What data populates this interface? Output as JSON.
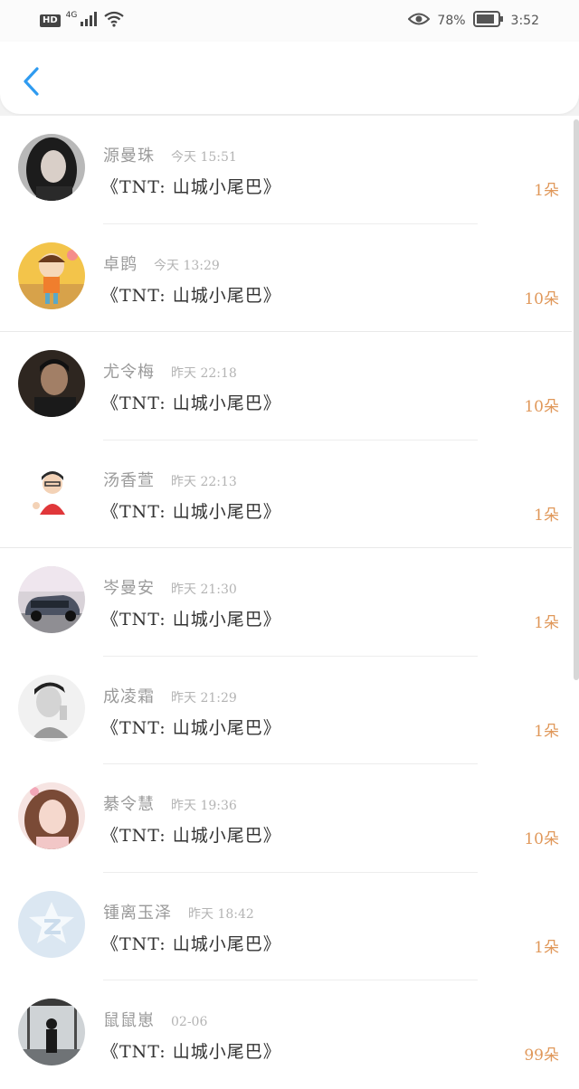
{
  "status_bar": {
    "hd": "HD",
    "network": "4G",
    "battery_percent": "78%",
    "time": "3:52"
  },
  "icons": {
    "back": "chevron-left-icon",
    "signal": "signal-icon",
    "wifi": "wifi-icon",
    "eye": "eye-icon",
    "battery": "battery-icon"
  },
  "colors": {
    "accent": "#2f9bf0",
    "count": "#e0985a"
  },
  "records": [
    {
      "name": "源曼珠",
      "time": "今天 15:51",
      "gift": "《TNT: 山城小尾巴》",
      "count": "1朵",
      "avatar": "girl-dark-hair"
    },
    {
      "name": "卓鹍",
      "time": "今天 13:29",
      "gift": "《TNT: 山城小尾巴》",
      "count": "10朵",
      "avatar": "cartoon-girl"
    },
    {
      "name": "尤令梅",
      "time": "昨天 22:18",
      "gift": "《TNT: 山城小尾巴》",
      "count": "10朵",
      "avatar": "boy-dark"
    },
    {
      "name": "汤香萱",
      "time": "昨天 22:13",
      "gift": "《TNT: 山城小尾巴》",
      "count": "1朵",
      "avatar": "cartoon-boy"
    },
    {
      "name": "岑曼安",
      "time": "昨天 21:30",
      "gift": "《TNT: 山城小尾巴》",
      "count": "1朵",
      "avatar": "car"
    },
    {
      "name": "成凌霜",
      "time": "昨天 21:29",
      "gift": "《TNT: 山城小尾巴》",
      "count": "1朵",
      "avatar": "boy-grayscale"
    },
    {
      "name": "綦令慧",
      "time": "昨天 19:36",
      "gift": "《TNT: 山城小尾巴》",
      "count": "10朵",
      "avatar": "girl-pink"
    },
    {
      "name": "锺离玉泽",
      "time": "昨天 18:42",
      "gift": "《TNT: 山城小尾巴》",
      "count": "1朵",
      "avatar": "default-star"
    },
    {
      "name": "鼠鼠崽",
      "time": "02-06",
      "gift": "《TNT: 山城小尾巴》",
      "count": "99朵",
      "avatar": "silhouette-window"
    }
  ]
}
